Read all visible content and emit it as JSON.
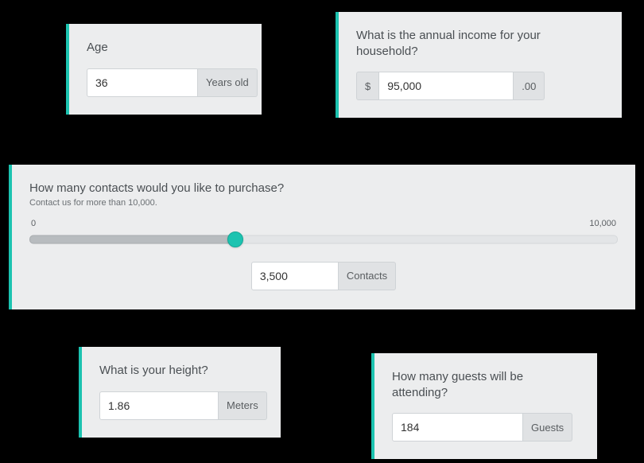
{
  "colors": {
    "accent": "#1cc3b0",
    "card_bg": "#ecedee"
  },
  "age": {
    "label": "Age",
    "value": "36",
    "unit": "Years old"
  },
  "income": {
    "label": "What is the annual income for your household?",
    "prefix": "$",
    "value": "95,000",
    "suffix": ".00"
  },
  "contacts": {
    "label": "How many contacts would you like to purchase?",
    "subtext": "Contact us for more than 10,000.",
    "min_label": "0",
    "max_label": "10,000",
    "min": 0,
    "max": 10000,
    "value_numeric": 3500,
    "value": "3,500",
    "unit": "Contacts"
  },
  "height": {
    "label": "What is your height?",
    "value": "1.86",
    "unit": "Meters"
  },
  "guests": {
    "label": "How many guests will be attending?",
    "value": "184",
    "unit": "Guests"
  }
}
